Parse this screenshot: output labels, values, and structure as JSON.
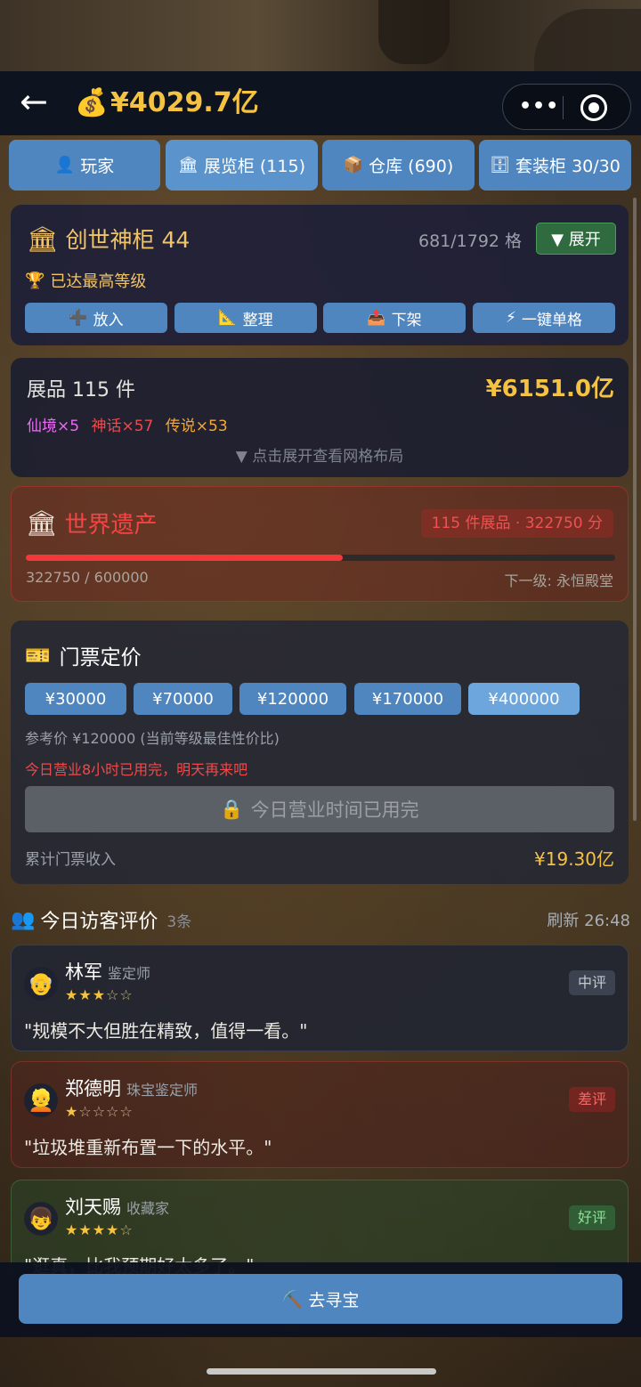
{
  "header": {
    "back_icon": "←",
    "money_icon": "💰",
    "money": "¥4029.7亿",
    "more_icon": "•••"
  },
  "tabs": [
    {
      "icon": "👤",
      "label": "玩家"
    },
    {
      "icon": "🏛",
      "label": "展览柜 (115)"
    },
    {
      "icon": "📦",
      "label": "仓库 (690)"
    },
    {
      "icon": "🗄",
      "label": "套装柜 30/30"
    }
  ],
  "cabinet": {
    "icon": "🏛",
    "title": "创世神柜 44",
    "slots": "681/1792 格",
    "expand_label": "▼ 展开",
    "max_icon": "🏆",
    "max_level": "已达最高等级",
    "buttons": [
      {
        "icon": "➕",
        "label": "放入"
      },
      {
        "icon": "📐",
        "label": "整理"
      },
      {
        "icon": "📤",
        "label": "下架"
      },
      {
        "icon": "⚡",
        "label": "一键单格"
      }
    ]
  },
  "exhibits": {
    "count": "展品 115 件",
    "value": "¥6151.0亿",
    "rarities": [
      {
        "label": "仙境×5",
        "color": "#e86cf0"
      },
      {
        "label": "神话×57",
        "color": "#f04a4a"
      },
      {
        "label": "传说×53",
        "color": "#f5a83a"
      }
    ],
    "hint": "▼ 点击展开查看网格布局"
  },
  "heritage": {
    "icon": "🏛",
    "title": "世界遗产",
    "pill": "115 件展品 · 322750 分",
    "progress_text": "322750 / 600000",
    "progress_value": 322750,
    "progress_max": 600000,
    "next_level": "下一级: 永恒殿堂"
  },
  "ticket": {
    "icon": "🎫",
    "title": "门票定价",
    "prices": [
      "¥30000",
      "¥70000",
      "¥120000",
      "¥170000",
      "¥400000"
    ],
    "selected_index": 4,
    "reference": "参考价 ¥120000 (当前等级最佳性价比)",
    "warning": "今日营业8小时已用完，明天再来吧",
    "lock_icon": "🔒",
    "disabled_label": "今日营业时间已用完",
    "income_label": "累计门票收入",
    "income_value": "¥19.30亿"
  },
  "visitors": {
    "icon": "👥",
    "title": "今日访客评价",
    "count": "3条",
    "refresh": "刷新 26:48",
    "reviews": [
      {
        "avatar": "👴",
        "name": "林军",
        "role": "鉴定师",
        "stars_filled": "★★★",
        "stars_empty": "☆☆",
        "tag": "中评",
        "text": "\"规模不大但胜在精致，值得一看。\""
      },
      {
        "avatar": "👱",
        "name": "郑德明",
        "role": "珠宝鉴定师",
        "stars_filled": "★",
        "stars_empty": "☆☆☆☆",
        "tag": "差评",
        "text": "\"垃圾堆重新布置一下的水平。\""
      },
      {
        "avatar": "👦",
        "name": "刘天赐",
        "role": "收藏家",
        "stars_filled": "★★★★",
        "stars_empty": "☆",
        "tag": "好评",
        "text": "\"逛真，比我预期好太多了。\""
      }
    ]
  },
  "bottom": {
    "icon": "⛏️",
    "label": "去寻宝"
  }
}
